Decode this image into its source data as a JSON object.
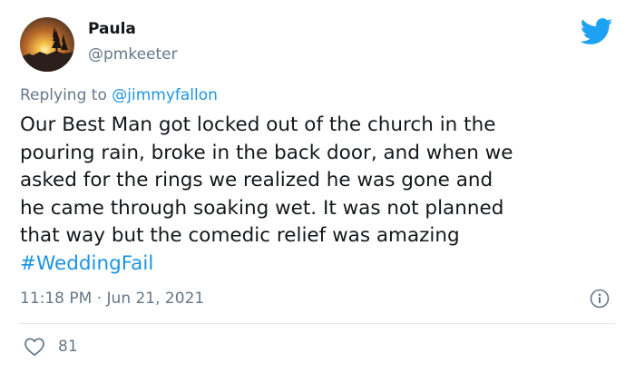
{
  "user": {
    "display_name": "Paula",
    "handle": "@pmkeeter"
  },
  "reply": {
    "prefix": "Replying to ",
    "mention": "@jimmyfallon"
  },
  "tweet": {
    "lines": [
      "Our Best Man got locked out of the church in the",
      "pouring rain, broke in the back door, and when we",
      "asked for the rings we realized he was gone and",
      "he came through soaking wet. It was not planned",
      "that way but the comedic relief was amazing"
    ],
    "hashtag": "#WeddingFail",
    "timestamp": "11:18 PM · Jun 21, 2021",
    "likes": "81"
  },
  "icons": {
    "brand": "twitter-bird-icon",
    "info": "info-icon",
    "like": "heart-icon"
  },
  "colors": {
    "accent": "#1da1f2",
    "link": "#1b95e0",
    "text": "#14171a",
    "muted": "#657786",
    "divider": "#e1e8ed"
  }
}
